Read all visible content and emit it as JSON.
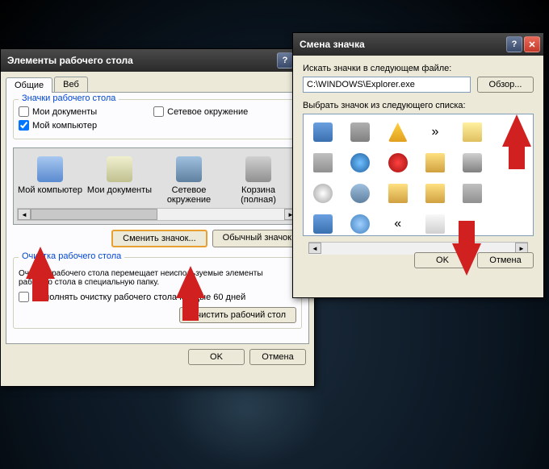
{
  "dialog1": {
    "title": "Элементы рабочего стола",
    "tabs": [
      "Общие",
      "Веб"
    ],
    "group_icons_title": "Значки рабочего стола",
    "checkboxes": {
      "my_docs": {
        "label": "Мои документы",
        "checked": false
      },
      "network": {
        "label": "Сетевое окружение",
        "checked": false
      },
      "my_computer": {
        "label": "Мой компьютер",
        "checked": true
      }
    },
    "icon_strip": [
      {
        "label": "Мой компьютер"
      },
      {
        "label": "Мои документы"
      },
      {
        "label": "Сетевое окружение"
      },
      {
        "label": "Корзина (полная)"
      }
    ],
    "change_icon_btn": "Сменить значок...",
    "default_icon_btn": "Обычный значок",
    "group_cleanup_title": "Очистка рабочего стола",
    "cleanup_text": "Очистка рабочего стола перемещает неиспользуемые элементы рабочего стола в специальную папку.",
    "cleanup_checkbox": "Выполнять очистку рабочего стола каждые 60 дней",
    "cleanup_btn": "Очистить рабочий стол",
    "ok": "OK",
    "cancel": "Отмена"
  },
  "dialog2": {
    "title": "Смена значка",
    "search_label": "Искать значки в следующем файле:",
    "path_value": "C:\\WINDOWS\\Explorer.exe",
    "browse_btn": "Обзор...",
    "select_label": "Выбрать значок из следующего списка:",
    "icons": [
      "monitor-icon",
      "printer-icon",
      "warning-icon",
      "arrows-icon",
      "mail-icon",
      "blank",
      "drive-icon",
      "globe-icon",
      "stop-icon",
      "folder-icon",
      "tower-icon",
      "blank",
      "disc-icon",
      "search-icon",
      "folder-icon",
      "folder-icon",
      "drive-icon",
      "blank",
      "monitor-icon",
      "info-icon",
      "chevrons-icon",
      "envelope-icon",
      "blank",
      "blank"
    ],
    "ok": "OK",
    "cancel": "Отмена"
  }
}
